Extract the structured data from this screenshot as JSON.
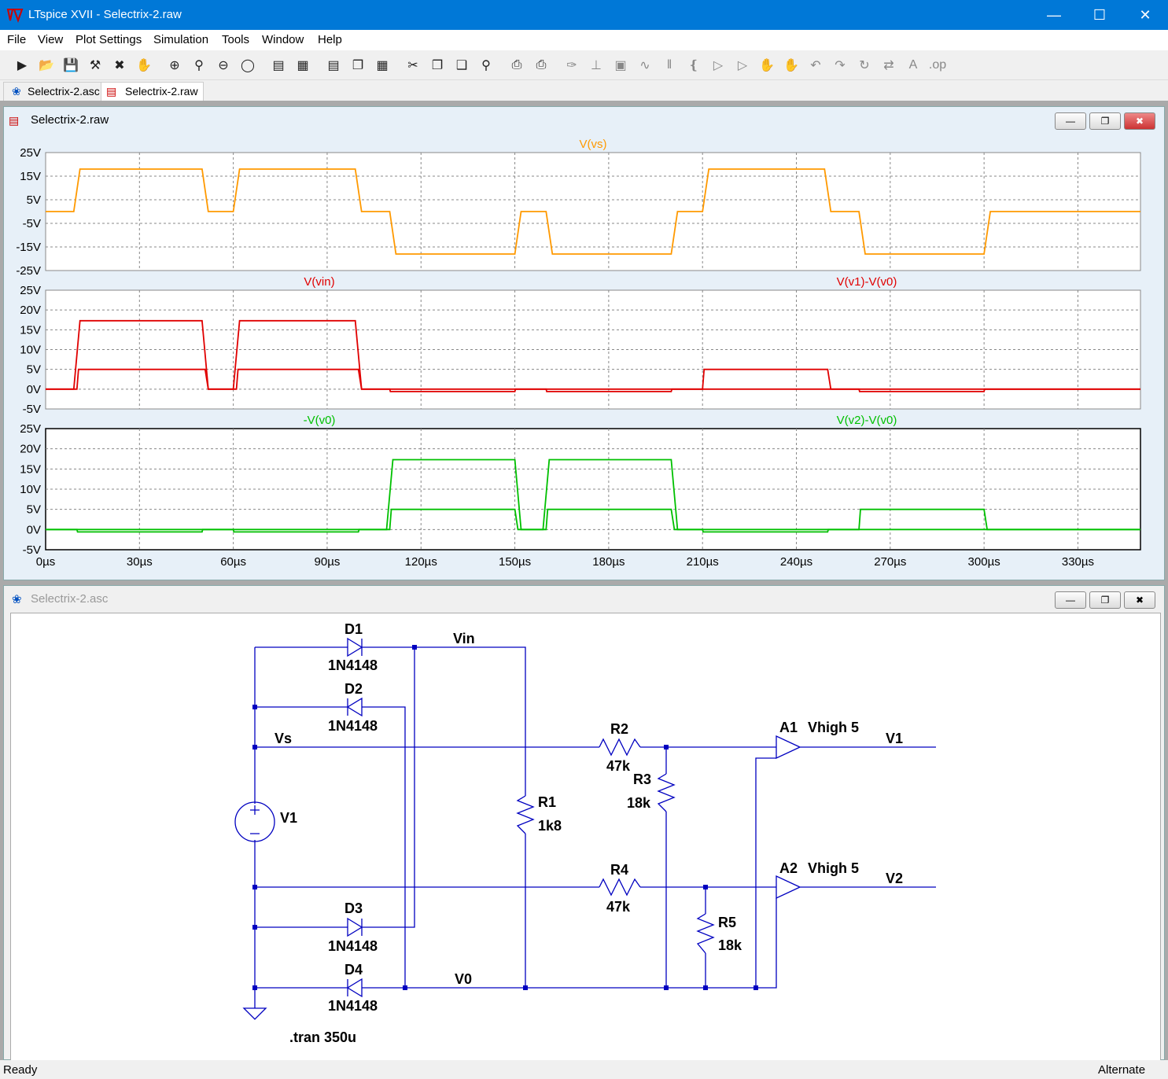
{
  "window": {
    "title": "LTspice XVII - Selectrix-2.raw"
  },
  "menu": [
    "File",
    "View",
    "Plot Settings",
    "Simulation",
    "Tools",
    "Window",
    "Help"
  ],
  "toolbar_icons": [
    "run-icon",
    "open-icon",
    "save-icon",
    "control-panel-icon",
    "halt-icon",
    "pan-icon",
    "zoom-in-icon",
    "zoom-area-icon",
    "zoom-out-icon",
    "zoom-fit-icon",
    "autorange-icon",
    "marker-icon",
    "tile-horizontal-icon",
    "cascade-icon",
    "tile-vertical-icon",
    "cut-icon",
    "copy-icon",
    "paste-icon",
    "find-icon",
    "print-setup-icon",
    "print-icon",
    "wire-icon",
    "ground-icon",
    "label-icon",
    "resistor-icon",
    "capacitor-icon",
    "inductor-icon",
    "diode-icon",
    "component-icon",
    "move-icon",
    "drag-icon",
    "undo-icon",
    "redo-icon",
    "rotate-icon",
    "mirror-icon",
    "text-icon",
    "spice-directive-icon"
  ],
  "tabs": [
    "Selectrix-2.asc",
    "Selectrix-2.raw"
  ],
  "waveform_window": {
    "title": "Selectrix-2.raw"
  },
  "schematic_window": {
    "title": "Selectrix-2.asc"
  },
  "status": {
    "left": "Ready",
    "right": "Alternate"
  },
  "colors": {
    "orange": "#ff9900",
    "red": "#e00000",
    "green": "#00c000",
    "wire": "#0000c0",
    "accent": "#0078d7"
  },
  "chart_data": [
    {
      "type": "line",
      "title": "",
      "traces": [
        {
          "name": "V(vs)",
          "color": "#ff9900"
        }
      ],
      "y_ticks": [
        "25V",
        "15V",
        "5V",
        "-5V",
        "-15V",
        "-25V"
      ],
      "ylim": [
        -25,
        25
      ],
      "xlim": [
        0,
        350
      ],
      "series": [
        {
          "name": "V(vs)",
          "x": [
            0,
            9,
            11,
            50,
            52,
            60,
            62,
            99,
            101,
            110,
            112,
            150,
            152,
            160,
            162,
            200,
            202,
            210,
            212,
            249,
            251,
            260,
            262,
            300,
            302,
            350
          ],
          "y": [
            0,
            0,
            18,
            18,
            0,
            0,
            18,
            18,
            0,
            0,
            -18,
            -18,
            0,
            0,
            -18,
            -18,
            0,
            0,
            18,
            18,
            0,
            0,
            -18,
            -18,
            0,
            0
          ]
        }
      ]
    },
    {
      "type": "line",
      "traces": [
        {
          "name": "V(vin)",
          "color": "#e00000"
        },
        {
          "name": "V(v1)-V(v0)",
          "color": "#e00000"
        }
      ],
      "y_ticks": [
        "25V",
        "20V",
        "15V",
        "10V",
        "5V",
        "0V",
        "-5V"
      ],
      "ylim": [
        -5,
        25
      ],
      "series": [
        {
          "name": "V(vin)",
          "x": [
            0,
            9,
            11,
            50,
            52,
            60,
            62,
            99,
            101,
            350
          ],
          "y": [
            0,
            0,
            17.3,
            17.3,
            0,
            0,
            17.3,
            17.3,
            0,
            0
          ]
        },
        {
          "name": "V(v1)-V(v0)",
          "x": [
            0,
            10,
            10.5,
            51,
            52,
            61,
            61.5,
            100,
            101,
            110,
            110.2,
            150,
            150.2,
            160,
            160.2,
            200,
            200.2,
            210,
            210.5,
            250,
            251,
            260,
            260.2,
            300,
            300.2,
            350
          ],
          "y": [
            0,
            0,
            5,
            5,
            0,
            0,
            5,
            5,
            0,
            0,
            -0.6,
            -0.6,
            0,
            0,
            -0.6,
            -0.6,
            0,
            0,
            5,
            5,
            0,
            0,
            -0.6,
            -0.6,
            0,
            0
          ]
        }
      ]
    },
    {
      "type": "line",
      "traces": [
        {
          "name": "-V(v0)",
          "color": "#00c000"
        },
        {
          "name": "V(v2)-V(v0)",
          "color": "#00c000"
        }
      ],
      "y_ticks": [
        "25V",
        "20V",
        "15V",
        "10V",
        "5V",
        "0V",
        "-5V"
      ],
      "x_ticks": [
        "0µs",
        "30µs",
        "60µs",
        "90µs",
        "120µs",
        "150µs",
        "180µs",
        "210µs",
        "240µs",
        "270µs",
        "300µs",
        "330µs"
      ],
      "ylim": [
        -5,
        25
      ],
      "series": [
        {
          "name": "-V(v0)",
          "x": [
            0,
            109,
            111,
            150,
            152,
            159,
            161,
            200,
            202,
            350
          ],
          "y": [
            0,
            0,
            17.3,
            17.3,
            0,
            0,
            17.3,
            17.3,
            0,
            0
          ]
        },
        {
          "name": "V(v2)-V(v0)",
          "x": [
            0,
            10,
            10.2,
            50,
            50.2,
            60,
            60.2,
            100,
            100.2,
            110,
            110.5,
            150,
            151,
            160,
            160.5,
            200,
            201,
            210,
            210.2,
            250,
            250.2,
            260,
            260.5,
            300,
            301,
            350
          ],
          "y": [
            0,
            0,
            -0.6,
            -0.6,
            0,
            0,
            -0.6,
            -0.6,
            0,
            0,
            5,
            5,
            0,
            0,
            5,
            5,
            0,
            0,
            -0.6,
            -0.6,
            0,
            0,
            5,
            5,
            0,
            0
          ]
        }
      ]
    }
  ],
  "schematic": {
    "labels": {
      "d1": "D1",
      "d2": "D2",
      "d3": "D3",
      "d4": "D4",
      "diode_model": "1N4148",
      "vin": "Vin",
      "vs": "Vs",
      "v0": "V0",
      "v1src": "V1",
      "r1": "R1",
      "r1v": "1k8",
      "r2": "R2",
      "r2v": "47k",
      "r3": "R3",
      "r3v": "18k",
      "r4": "R4",
      "r4v": "47k",
      "r5": "R5",
      "r5v": "18k",
      "a1": "A1",
      "a2": "A2",
      "vhigh": "Vhigh 5",
      "v1out": "V1",
      "v2out": "V2",
      "tran": ".tran 350u"
    }
  }
}
